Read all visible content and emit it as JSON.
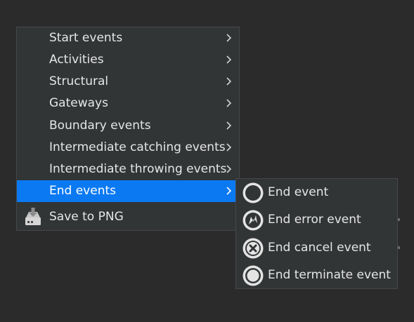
{
  "context_menu": {
    "items": [
      {
        "label": "Start events",
        "has_submenu": true
      },
      {
        "label": "Activities",
        "has_submenu": true
      },
      {
        "label": "Structural",
        "has_submenu": true
      },
      {
        "label": "Gateways",
        "has_submenu": true
      },
      {
        "label": "Boundary events",
        "has_submenu": true
      },
      {
        "label": "Intermediate catching events",
        "has_submenu": true
      },
      {
        "label": "Intermediate throwing events",
        "has_submenu": true
      },
      {
        "label": "End events",
        "has_submenu": true,
        "active": true
      },
      {
        "label": "Save to PNG",
        "icon": "save-disk-icon"
      }
    ]
  },
  "submenu": {
    "items": [
      {
        "label": "End event",
        "icon": "end-event-icon"
      },
      {
        "label": "End error event",
        "icon": "end-error-event-icon"
      },
      {
        "label": "End cancel event",
        "icon": "end-cancel-event-icon"
      },
      {
        "label": "End terminate event",
        "icon": "end-terminate-event-icon"
      }
    ]
  },
  "colors": {
    "background": "#2b2b2b",
    "menu_bg": "#323536",
    "highlight": "#0a79f2",
    "text": "#e6e6e6"
  }
}
